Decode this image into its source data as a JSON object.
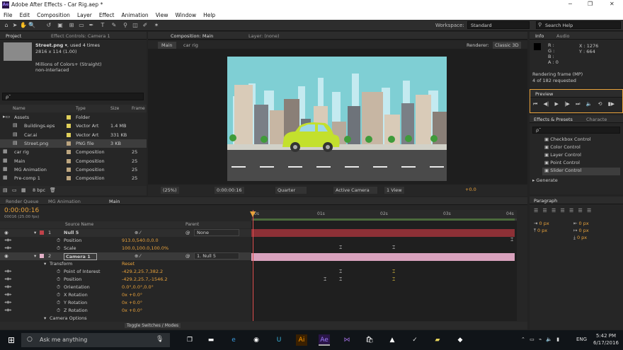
{
  "window": {
    "title": "Adobe After Effects - Car Rig.aep *",
    "app_icon": "Ae"
  },
  "menu": [
    "File",
    "Edit",
    "Composition",
    "Layer",
    "Effect",
    "Animation",
    "View",
    "Window",
    "Help"
  ],
  "toolbar": {
    "workspace_label": "Workspace:",
    "workspace_value": "Standard",
    "search_placeholder": "Search Help"
  },
  "project": {
    "tab_project": "Project",
    "tab_effect_controls": "Effect Controls: Camera 1",
    "preview_name": "Street.png ▾",
    "preview_used": ", used 4 times",
    "preview_dims": "2816 x 114 (1.00)",
    "preview_colors": "Millions of Colors+ (Straight)",
    "preview_interlace": "non-interlaced",
    "search_placeholder": "ρ˜",
    "columns": {
      "name": "Name",
      "type": "Type",
      "size": "Size",
      "frame": "Frame"
    },
    "items": [
      {
        "name": "Assets",
        "type": "Folder",
        "size": "",
        "frame": "",
        "color": "#e0d05a",
        "indent": 0,
        "icon": "folder-icon"
      },
      {
        "name": "Buildings.eps",
        "type": "Vector Art",
        "size": "1.4 MB",
        "frame": "",
        "color": "#e0d05a",
        "indent": 1,
        "icon": "file-icon"
      },
      {
        "name": "Car.ai",
        "type": "Vector Art",
        "size": "331 KB",
        "frame": "",
        "color": "#e0d05a",
        "indent": 1,
        "icon": "file-icon"
      },
      {
        "name": "Street.png",
        "type": "PNG file",
        "size": "3 KB",
        "frame": "",
        "color": "#bca57f",
        "indent": 1,
        "icon": "file-icon"
      },
      {
        "name": "car rig",
        "type": "Composition",
        "size": "",
        "frame": "25",
        "color": "#bca57f",
        "indent": 0,
        "icon": "comp-icon"
      },
      {
        "name": "Main",
        "type": "Composition",
        "size": "",
        "frame": "25",
        "color": "#bca57f",
        "indent": 0,
        "icon": "comp-icon"
      },
      {
        "name": "MG Animation",
        "type": "Composition",
        "size": "",
        "frame": "25",
        "color": "#bca57f",
        "indent": 0,
        "icon": "comp-icon"
      },
      {
        "name": "Pre-comp 1",
        "type": "Composition",
        "size": "",
        "frame": "25",
        "color": "#bca57f",
        "indent": 0,
        "icon": "comp-icon"
      }
    ],
    "bpc": "8 bpc"
  },
  "comp": {
    "tab_comp": "Composition: Main",
    "tab_layer": "Layer: (none)",
    "breadcrumb_main": "Main",
    "breadcrumb_carrig": "car rig",
    "renderer_label": "Renderer:",
    "renderer_value": "Classic 3D",
    "zoom": "(25%)",
    "timecode": "0:00:00:16",
    "quality": "Quarter",
    "camera": "Active Camera",
    "view": "1 View",
    "exposure": "+0.0"
  },
  "info": {
    "tab_info": "Info",
    "tab_audio": "Audio",
    "r": "R :",
    "g": "G :",
    "b": "B :",
    "a": "A : 0",
    "x": "X : 1276",
    "y": "Y : 664",
    "rendering": "Rendering frame (MP)",
    "requested": "4 of 182 requested"
  },
  "preview": {
    "tab": "Preview"
  },
  "effects": {
    "tab": "Effects & Presets",
    "tab2": "Characte",
    "search": "ρ˜",
    "items": [
      "Checkbox Control",
      "Color Control",
      "Layer Control",
      "Point Control",
      "Slider Control"
    ],
    "generate": "Generate"
  },
  "paragraph": {
    "tab": "Paragraph",
    "indent_left": "0 px",
    "indent_right": "0 px",
    "indent_first": "0 px",
    "space_before": "0 px",
    "space_after": "0 px"
  },
  "timeline": {
    "tab_render": "Render Queue",
    "tab_mg": "MG Animation",
    "tab_main": "Main",
    "timecode": "0:00:00:16",
    "fps": "00016 (25.00 fps)",
    "col_source": "Source Name",
    "col_parent": "Parent",
    "ruler": [
      "0s",
      "01s",
      "02s",
      "03s",
      "04s"
    ],
    "toggle": "Toggle Switches / Modes",
    "layers": [
      {
        "kind": "layer",
        "num": "1",
        "name": "Null 5",
        "parent": "None",
        "color": "#c0424a"
      },
      {
        "kind": "prop",
        "name": "Position",
        "value": "913.0,540.0,0.0"
      },
      {
        "kind": "prop",
        "name": "Scale",
        "value": "100.0,100.0,100.0%"
      },
      {
        "kind": "layer",
        "num": "2",
        "name": "Camera 1",
        "parent": "1. Null 5",
        "color": "#e3b1c8"
      },
      {
        "kind": "group",
        "name": "Transform",
        "value": "Reset"
      },
      {
        "kind": "prop",
        "name": "Point of Interest",
        "value": "-429.2,25.7,382.2"
      },
      {
        "kind": "prop",
        "name": "Position",
        "value": "-429.2,25.7,-1546.2"
      },
      {
        "kind": "prop",
        "name": "Orientation",
        "value": "0.0°,0.0°,0.0°"
      },
      {
        "kind": "prop",
        "name": "X Rotation",
        "value": "0x +0.0°"
      },
      {
        "kind": "prop",
        "name": "Y Rotation",
        "value": "0x +0.0°"
      },
      {
        "kind": "prop",
        "name": "Z Rotation",
        "value": "0x +0.0°"
      },
      {
        "kind": "group",
        "name": "Camera Options",
        "value": ""
      }
    ]
  },
  "taskbar": {
    "search": "Ask me anything",
    "time": "5:42 PM",
    "date": "6/17/2016",
    "lang": "ENG"
  },
  "colors": {
    "accent": "#e9a23b",
    "label_red": "#c0424a",
    "label_pink": "#e3b1c8",
    "sky": "#7fcfd4"
  }
}
